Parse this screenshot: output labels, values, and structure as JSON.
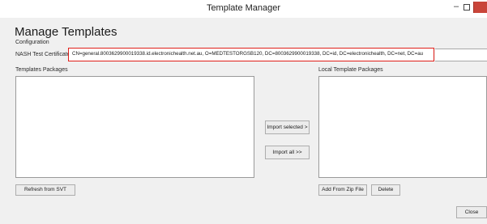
{
  "window": {
    "title": "Template Manager",
    "minimize_glyph": "–",
    "maximize_glyph": "",
    "close_color": "#c9453a"
  },
  "header": {
    "title": "Manage Templates",
    "configuration_label": "Configuration"
  },
  "nash": {
    "label": "NASH Test Certificate",
    "value": "CN=general.8003629900019338.id.electronichealth.net.au, O=MEDTESTORGSB120, DC=8003629900019338, DC=id, DC=electronichealth, DC=net, DC=au",
    "highlight_color": "#e0201a"
  },
  "templates_packages": {
    "label": "Templates Packages",
    "items": []
  },
  "local_template_packages": {
    "label": "Local Template Packages",
    "items": []
  },
  "buttons": {
    "import_selected": "Import selected >",
    "import_all": "Import all >>",
    "refresh_from_svt": "Refresh from SVT",
    "add_from_zip": "Add From Zip File",
    "delete": "Delete",
    "close": "Close"
  }
}
